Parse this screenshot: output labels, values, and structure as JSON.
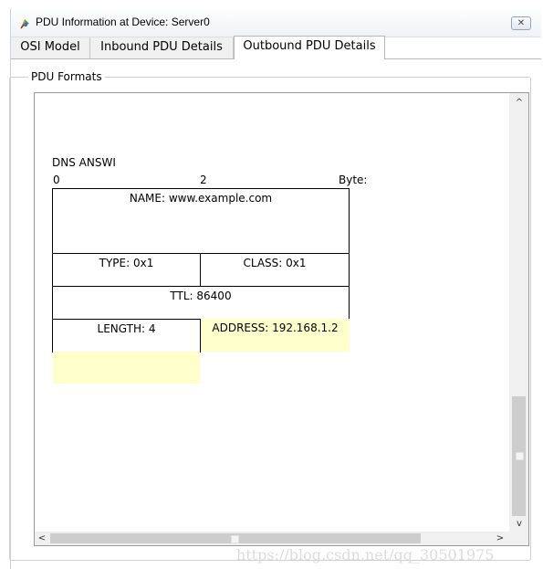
{
  "window": {
    "title": "PDU Information at Device: Server0",
    "close_label": "✕",
    "icon": "packet-tracer-icon"
  },
  "tabs": [
    {
      "label": "OSI Model",
      "active": false
    },
    {
      "label": "Inbound PDU Details",
      "active": false
    },
    {
      "label": "Outbound PDU Details",
      "active": true
    }
  ],
  "group": {
    "label": "PDU Formats"
  },
  "pdu": {
    "header": "DNS ANSWI",
    "ruler": {
      "start": "0",
      "mid": "2",
      "unit": "Byte:"
    },
    "fields": {
      "name": "NAME: www.example.com",
      "type": "TYPE: 0x1",
      "class": "CLASS: 0x1",
      "ttl": "TTL: 86400",
      "length": "LENGTH: 4",
      "address": "ADDRESS: 192.168.1.2"
    }
  },
  "scrollbars": {
    "up_arrow": "^",
    "down_arrow": "v",
    "left_arrow": "<",
    "right_arrow": ">"
  },
  "watermark": "https://blog.csdn.net/qq_30501975",
  "colors": {
    "highlight": "#ffffcc",
    "active_tab": "#ffffff",
    "inactive_tab": "#f0f0f0"
  }
}
